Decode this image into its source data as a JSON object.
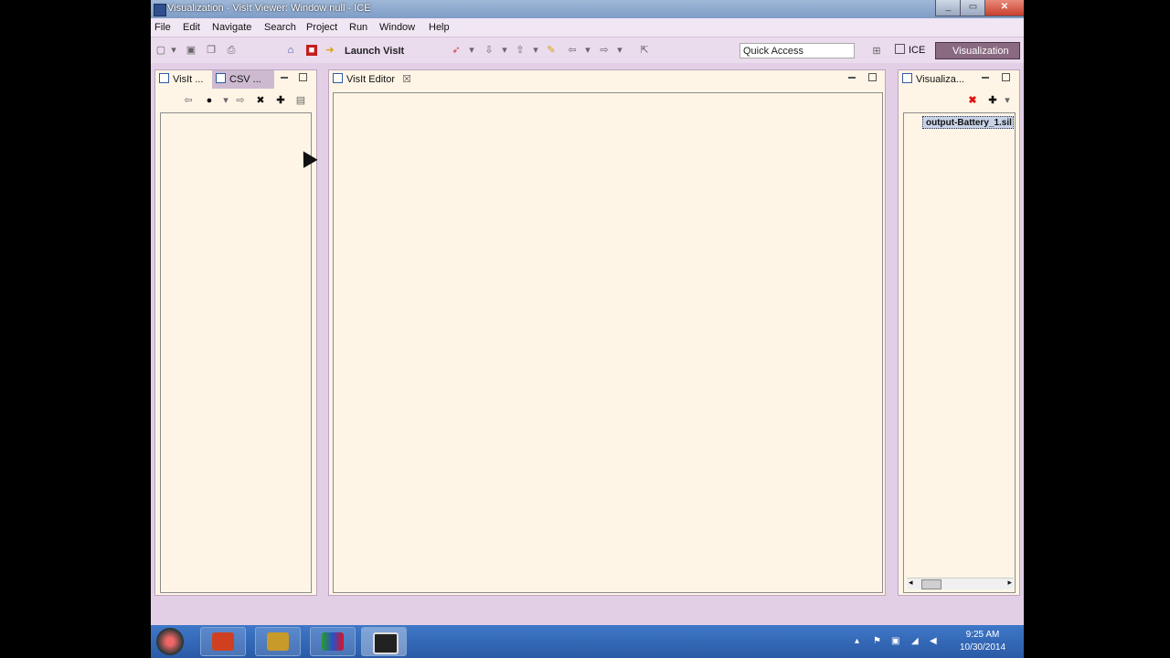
{
  "window": {
    "title": "Visualization - VisIt Viewer: Window null - ICE"
  },
  "menubar": {
    "items": [
      "File",
      "Edit",
      "Navigate",
      "Search",
      "Project",
      "Run",
      "Window",
      "Help"
    ]
  },
  "toolbar": {
    "launch_label": "Launch VisIt",
    "quick_access_value": "Quick Access",
    "perspective_ice": "ICE",
    "perspective_visualization": "Visualization"
  },
  "left_panel": {
    "tabs": [
      "VisIt ...",
      "CSV ..."
    ]
  },
  "editor": {
    "tab_label": "VisIt Editor"
  },
  "right_panel": {
    "tab_label": "Visualiza...",
    "items": [
      "output-Battery_1.sil"
    ]
  },
  "taskbar": {
    "time": "9:25 AM",
    "date": "10/30/2014"
  },
  "colors": {
    "window_bg": "#e2cfe6",
    "panel_bg": "#fff5e6",
    "taskbar": "#2a5aa6",
    "active_perspective": "#8a6a80"
  }
}
